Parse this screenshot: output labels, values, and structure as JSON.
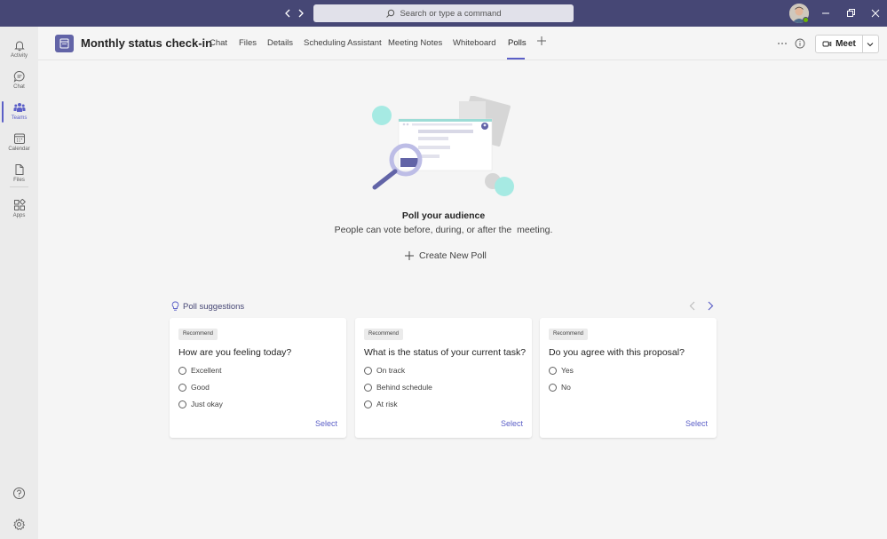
{
  "search": {
    "placeholder": "Search or type a command"
  },
  "rail": {
    "items": [
      {
        "label": "Activity",
        "icon": "bell-icon"
      },
      {
        "label": "Chat",
        "icon": "chat-icon"
      },
      {
        "label": "Teams",
        "icon": "teams-icon"
      },
      {
        "label": "Calendar",
        "icon": "calendar-icon"
      },
      {
        "label": "Files",
        "icon": "file-icon"
      },
      {
        "label": "Apps",
        "icon": "apps-icon"
      }
    ],
    "bottom": [
      {
        "icon": "help-icon"
      },
      {
        "icon": "gear-icon"
      }
    ]
  },
  "header": {
    "title": "Monthly status check-in",
    "tabs": [
      "Chat",
      "Files",
      "Details",
      "Scheduling Assistant",
      "Meeting Notes",
      "Whiteboard",
      "Polls"
    ],
    "active_tab": "Polls",
    "meet_label": "Meet"
  },
  "empty_state": {
    "title": "Poll your audience",
    "subtitle": "People can vote before, during, or after the  meeting.",
    "create_label": "Create New Poll"
  },
  "suggestions": {
    "heading": "Poll suggestions",
    "cards": [
      {
        "badge": "Recommend",
        "question": "How are you feeling today?",
        "options": [
          "Excellent",
          "Good",
          "Just okay"
        ],
        "select_label": "Select"
      },
      {
        "badge": "Recommend",
        "question": "What is the status of your current task?",
        "options": [
          "On track",
          "Behind schedule",
          "At risk"
        ],
        "select_label": "Select"
      },
      {
        "badge": "Recommend",
        "question": "Do you agree with this proposal?",
        "options": [
          "Yes",
          "No"
        ],
        "select_label": "Select"
      }
    ]
  },
  "colors": {
    "titlebar": "#464775",
    "accent": "#5b5fc7",
    "rail": "#ebebeb",
    "background": "#f5f5f5"
  }
}
